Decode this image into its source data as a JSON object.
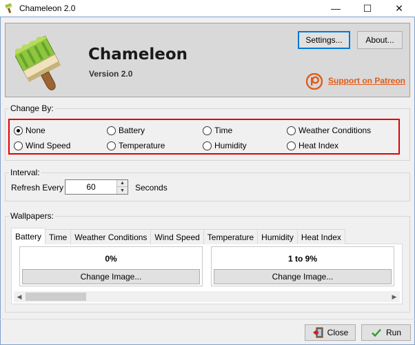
{
  "window": {
    "title": "Chameleon 2.0",
    "minimize": "—",
    "maximize": "☐",
    "close": "✕"
  },
  "header": {
    "app_name": "Chameleon",
    "version": "Version 2.0",
    "settings_label": "Settings...",
    "about_label": "About...",
    "patreon_label": "Support on Patreon"
  },
  "change_by": {
    "label": "Change By:",
    "selected": "None",
    "options": [
      "None",
      "Battery",
      "Time",
      "Weather Conditions",
      "Wind Speed",
      "Temperature",
      "Humidity",
      "Heat Index"
    ]
  },
  "interval": {
    "label": "Interval:",
    "refresh_label": "Refresh Every",
    "value": "60",
    "unit": "Seconds"
  },
  "wallpapers": {
    "label": "Wallpapers:",
    "tabs": [
      "Battery",
      "Time",
      "Weather Conditions",
      "Wind Speed",
      "Temperature",
      "Humidity",
      "Heat Index"
    ],
    "active_tab": "Battery",
    "cards": [
      {
        "title": "0%",
        "button": "Change Image..."
      },
      {
        "title": "1 to 9%",
        "button": "Change Image..."
      }
    ]
  },
  "footer": {
    "close_label": "Close",
    "run_label": "Run"
  },
  "colors": {
    "accent": "#0078d7",
    "highlight": "#e00000",
    "patreon": "#e05b1a",
    "run_check": "#2e9a2e"
  },
  "icons": {
    "app": "paintbrush-icon",
    "patreon": "patreon-icon",
    "close": "exit-door-icon",
    "run": "checkmark-icon"
  }
}
